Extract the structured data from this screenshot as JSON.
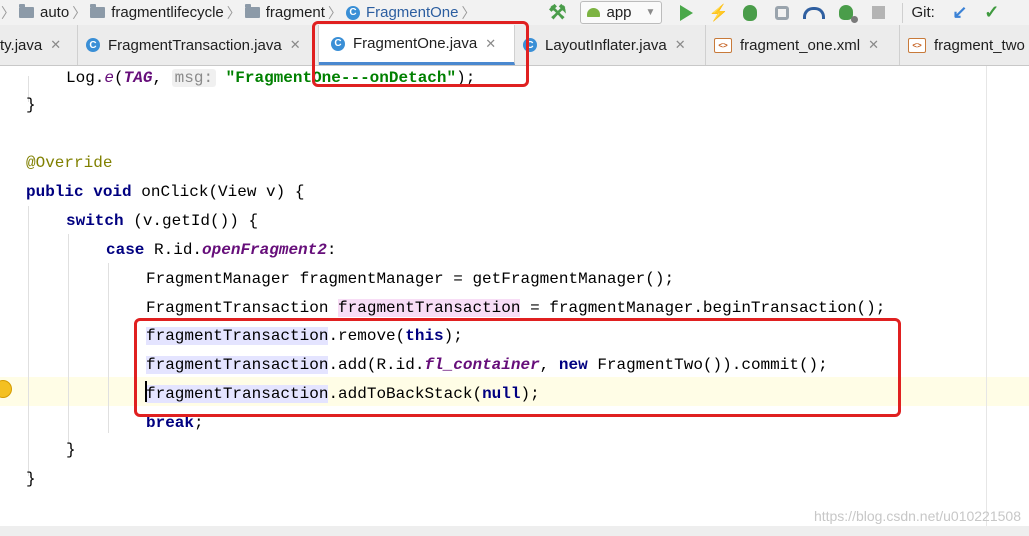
{
  "breadcrumbs": [
    {
      "label": "auto",
      "icon": "folder-icon"
    },
    {
      "label": "fragmentlifecycle",
      "icon": "folder-icon"
    },
    {
      "label": "fragment",
      "icon": "folder-icon"
    },
    {
      "label": "FragmentOne",
      "icon": "class-icon"
    }
  ],
  "toolbar": {
    "run_config": "app",
    "git_label": "Git:"
  },
  "tabs": [
    {
      "label": "ty.java",
      "type": "java",
      "active": false
    },
    {
      "label": "FragmentTransaction.java",
      "type": "java",
      "active": false
    },
    {
      "label": "FragmentOne.java",
      "type": "java",
      "active": true
    },
    {
      "label": "LayoutInflater.java",
      "type": "java",
      "active": false
    },
    {
      "label": "fragment_one.xml",
      "type": "xml",
      "active": false
    },
    {
      "label": "fragment_two",
      "type": "xml",
      "active": false
    }
  ],
  "code": {
    "l1_call": "Log.",
    "l1_method": "e",
    "l1_tag": "TAG",
    "l1_hint": "msg:",
    "l1_string": "\"FragmentOne---onDetach\"",
    "l1_end": ");",
    "l2": "}",
    "l4": "@Override",
    "l5_kw1": "public",
    "l5_kw2": "void",
    "l5_rest": "onClick(View v) {",
    "l6_kw": "switch",
    "l6_rest": "(v.getId()) {",
    "l7_kw": "case",
    "l7_prefix": "R.id.",
    "l7_const": "openFragment2",
    "l7_end": ":",
    "l8": "FragmentManager fragmentManager = getFragmentManager();",
    "l9_type": "FragmentTransaction",
    "l9_var": "fragmentTransaction",
    "l9_rest": "= fragmentManager.beginTransaction();",
    "l10_var": "fragmentTransaction",
    "l10_call": ".remove(",
    "l10_kw": "this",
    "l10_end": ");",
    "l11_var": "fragmentTransaction",
    "l11_call": ".add(R.id.",
    "l11_const": "fl_container",
    "l11_comma": ",",
    "l11_kw": "new",
    "l11_rest": "FragmentTwo()).commit();",
    "l12_var": "fragmentTransaction",
    "l12_call": ".addToBackStack(",
    "l12_kw": "null",
    "l12_end": ");",
    "l13_kw": "break",
    "l13_end": ";",
    "l14": "}",
    "l15": "}"
  },
  "watermark": "https://blog.csdn.net/u010221508",
  "colors": {
    "keyword": "#000080",
    "string": "#008000",
    "constant": "#660e7a",
    "annotation": "#808000",
    "highlight_box": "#e02020",
    "active_tab_underline": "#4a88cf"
  }
}
